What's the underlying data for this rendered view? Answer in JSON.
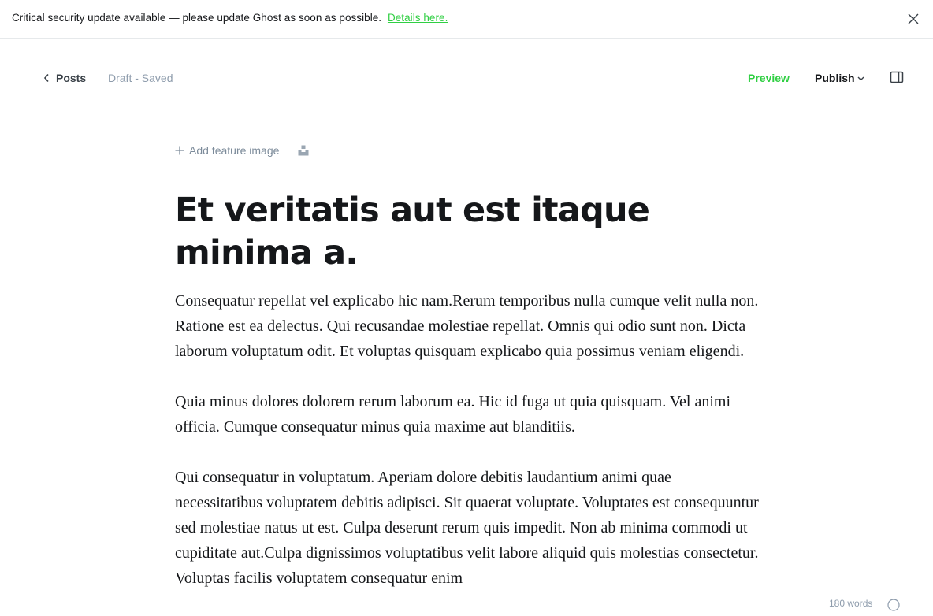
{
  "banner": {
    "message": "Critical security update available — please update Ghost as soon as possible.",
    "link_label": "Details here.",
    "close_icon": "close-icon"
  },
  "header": {
    "back_label": "Posts",
    "status": "Draft - Saved",
    "preview_label": "Preview",
    "publish_label": "Publish",
    "sidebar_toggle_icon": "sidebar-toggle-icon"
  },
  "feature_image": {
    "add_label": "Add feature image",
    "unsplash_icon": "unsplash-icon"
  },
  "post": {
    "title": "Et veritatis aut est itaque minima a.",
    "paragraphs": [
      "Consequatur repellat vel explicabo hic nam.Rerum temporibus nulla cumque velit nulla non. Ratione est ea delectus. Qui recusandae molestiae repellat. Omnis qui odio sunt non. Dicta laborum voluptatum odit. Et voluptas quisquam explicabo quia possimus veniam eligendi.",
      "Quia minus dolores dolorem rerum laborum ea. Hic id fuga ut quia quisquam. Vel animi officia. Cumque consequatur minus quia maxime aut blanditiis.",
      "Qui consequatur in voluptatum. Aperiam dolore debitis laudantium animi quae necessitatibus voluptatem debitis adipisci. Sit quaerat voluptate. Voluptates est consequuntur sed molestiae natus ut est. Culpa deserunt rerum quis impedit. Non ab minima commodi ut cupiditate aut.Culpa dignissimos voluptatibus velit labore aliquid quis molestias consectetur. Voluptas facilis voluptatem consequatur enim"
    ]
  },
  "footer": {
    "word_count": "180 words",
    "help_icon": "help-icon"
  },
  "colors": {
    "accent_green": "#30cf43",
    "text": "#15171a",
    "muted": "#8e9cac",
    "spellcheck": "#e2302f"
  }
}
